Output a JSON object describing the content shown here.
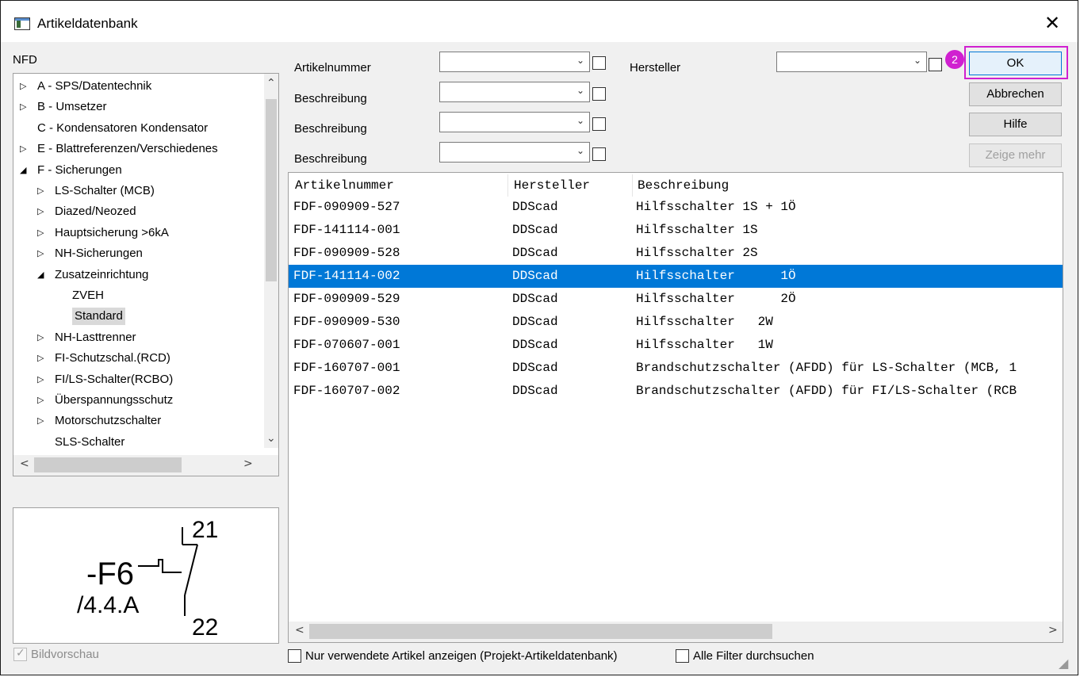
{
  "window": {
    "title": "Artikeldatenbank",
    "close_symbol": "✕"
  },
  "tree": {
    "label": "NFD",
    "items": [
      {
        "label": "A - SPS/Datentechnik",
        "twisty": "▷"
      },
      {
        "label": "B - Umsetzer",
        "twisty": "▷"
      },
      {
        "label": "C - Kondensatoren Kondensator",
        "twisty": ""
      },
      {
        "label": "E - Blattreferenzen/Verschiedenes",
        "twisty": "▷"
      },
      {
        "label": "F - Sicherungen",
        "twisty": "◢"
      },
      {
        "label": "LS-Schalter (MCB)",
        "twisty": "▷"
      },
      {
        "label": "Diazed/Neozed",
        "twisty": "▷"
      },
      {
        "label": "Hauptsicherung >6kA",
        "twisty": "▷"
      },
      {
        "label": "NH-Sicherungen",
        "twisty": "▷"
      },
      {
        "label": "Zusatzeinrichtung",
        "twisty": "◢"
      },
      {
        "label": "ZVEH",
        "twisty": ""
      },
      {
        "label": "Standard",
        "twisty": "",
        "selected": true
      },
      {
        "label": "NH-Lasttrenner",
        "twisty": "▷"
      },
      {
        "label": "FI-Schutzschal.(RCD)",
        "twisty": "▷"
      },
      {
        "label": "FI/LS-Schalter(RCBO)",
        "twisty": "▷"
      },
      {
        "label": "Überspannungsschutz",
        "twisty": "▷"
      },
      {
        "label": "Motorschutzschalter",
        "twisty": "▷"
      },
      {
        "label": "SLS-Schalter",
        "twisty": ""
      }
    ]
  },
  "preview": {
    "designation": "-F6",
    "reference": "/4.4.A",
    "terminal_top": "21",
    "terminal_bottom": "22",
    "checkbox_label": "Bildvorschau",
    "checkbox_checked": true,
    "checkbox_disabled": true
  },
  "filters": [
    {
      "label": "Artikelnummer",
      "value": ""
    },
    {
      "label": "Beschreibung",
      "value": ""
    },
    {
      "label": "Beschreibung",
      "value": ""
    },
    {
      "label": "Beschreibung",
      "value": ""
    }
  ],
  "manufacturer_filter": {
    "label": "Hersteller",
    "value": ""
  },
  "buttons": {
    "ok": "OK",
    "cancel": "Abbrechen",
    "help": "Hilfe",
    "more": "Zeige mehr"
  },
  "annotation": {
    "badge": "2",
    "color": "#d020d0"
  },
  "table": {
    "columns": [
      "Artikelnummer",
      "Hersteller",
      "Beschreibung"
    ],
    "rows": [
      [
        "FDF-090909-527",
        "DDScad",
        "Hilfsschalter 1S + 1Ö"
      ],
      [
        "FDF-141114-001",
        "DDScad",
        "Hilfsschalter 1S"
      ],
      [
        "FDF-090909-528",
        "DDScad",
        "Hilfsschalter 2S"
      ],
      [
        "FDF-141114-002",
        "DDScad",
        "Hilfsschalter      1Ö"
      ],
      [
        "FDF-090909-529",
        "DDScad",
        "Hilfsschalter      2Ö"
      ],
      [
        "FDF-090909-530",
        "DDScad",
        "Hilfsschalter   2W"
      ],
      [
        "FDF-070607-001",
        "DDScad",
        "Hilfsschalter   1W"
      ],
      [
        "FDF-160707-001",
        "DDScad",
        "Brandschutzschalter (AFDD) für LS-Schalter (MCB, 1"
      ],
      [
        "FDF-160707-002",
        "DDScad",
        "Brandschutzschalter (AFDD) für FI/LS-Schalter (RCB"
      ]
    ],
    "selected_row": 3
  },
  "footer": {
    "used_only_label": "Nur verwendete Artikel anzeigen (Projekt-Artikeldatenbank)",
    "all_filters_label": "Alle Filter durchsuchen"
  },
  "colors": {
    "selection": "#0078d7",
    "ok_border": "#0078d7"
  }
}
